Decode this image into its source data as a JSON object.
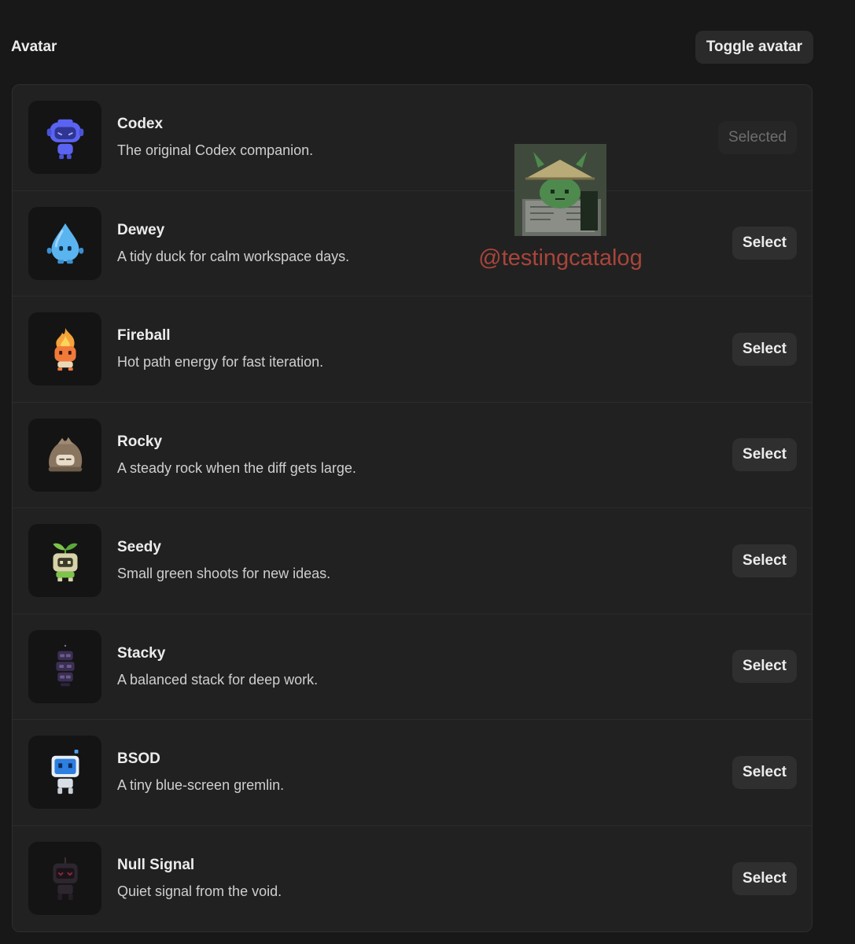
{
  "header": {
    "title": "Avatar",
    "toggle_label": "Toggle avatar"
  },
  "avatars": [
    {
      "name": "Codex",
      "description": "The original Codex companion.",
      "action": "Selected",
      "selected": true,
      "icon": "codex-robot-icon",
      "color": "#5b63f2"
    },
    {
      "name": "Dewey",
      "description": "A tidy duck for calm workspace days.",
      "action": "Select",
      "selected": false,
      "icon": "water-drop-icon",
      "color": "#5ab4f0"
    },
    {
      "name": "Fireball",
      "description": "Hot path energy for fast iteration.",
      "action": "Select",
      "selected": false,
      "icon": "fireball-icon",
      "color": "#f07a3a"
    },
    {
      "name": "Rocky",
      "description": "A steady rock when the diff gets large.",
      "action": "Select",
      "selected": false,
      "icon": "rock-icon",
      "color": "#a08a72"
    },
    {
      "name": "Seedy",
      "description": "Small green shoots for new ideas.",
      "action": "Select",
      "selected": false,
      "icon": "seedling-icon",
      "color": "#d8d2a8"
    },
    {
      "name": "Stacky",
      "description": "A balanced stack for deep work.",
      "action": "Select",
      "selected": false,
      "icon": "stack-icon",
      "color": "#6c5a8c"
    },
    {
      "name": "BSOD",
      "description": "A tiny blue-screen gremlin.",
      "action": "Select",
      "selected": false,
      "icon": "monitor-robot-icon",
      "color": "#4aa0ec"
    },
    {
      "name": "Null Signal",
      "description": "Quiet signal from the void.",
      "action": "Select",
      "selected": false,
      "icon": "null-signal-robot-icon",
      "color": "#3a2f3a"
    }
  ],
  "watermark": {
    "text": "@testingcatalog",
    "icon": "goblin-reading-icon"
  }
}
